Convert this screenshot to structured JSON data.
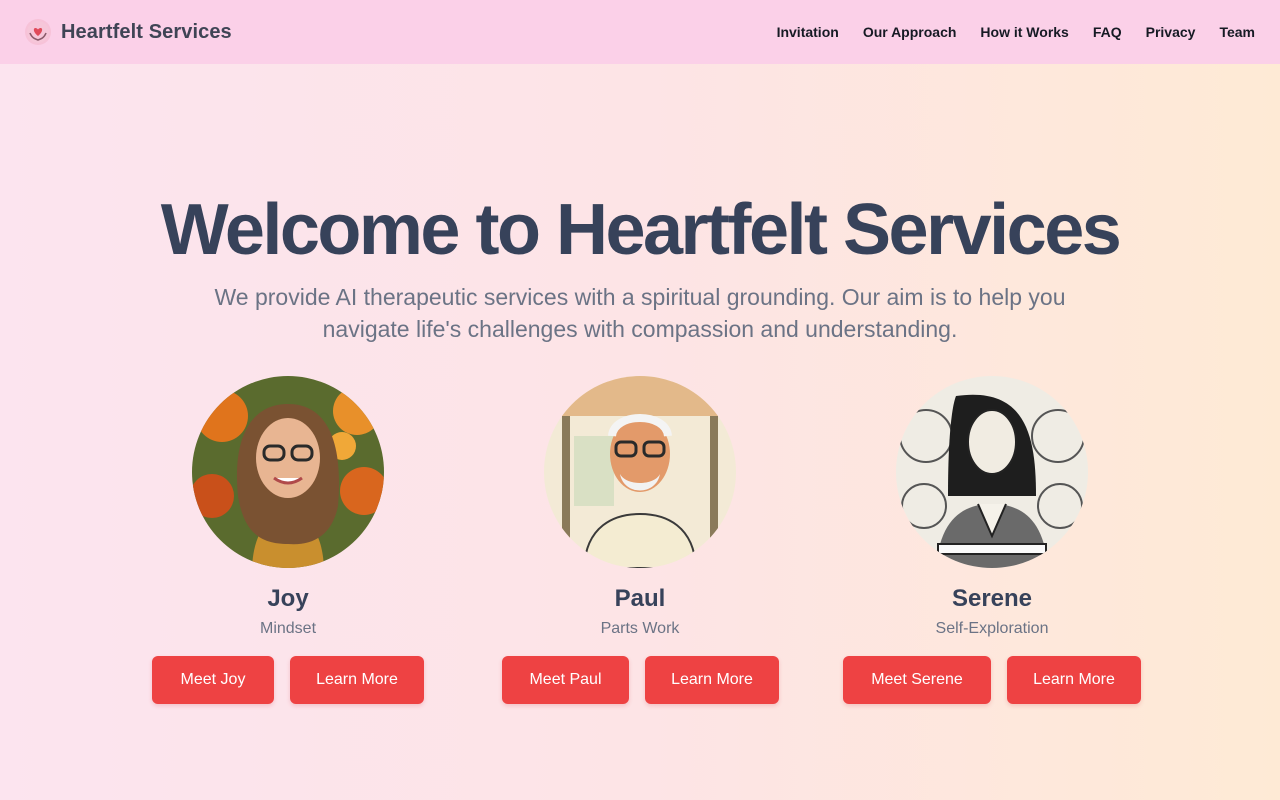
{
  "header": {
    "brand": "Heartfelt Services",
    "nav": [
      "Invitation",
      "Our Approach",
      "How it Works",
      "FAQ",
      "Privacy",
      "Team"
    ]
  },
  "hero": {
    "title": "Welcome to Heartfelt Services",
    "subtitle": "We provide AI therapeutic services with a spiritual grounding. Our aim is to help you navigate life's challenges with compassion and understanding."
  },
  "therapists": [
    {
      "name": "Joy",
      "role": "Mindset",
      "meet_label": "Meet Joy",
      "learn_label": "Learn More"
    },
    {
      "name": "Paul",
      "role": "Parts Work",
      "meet_label": "Meet Paul",
      "learn_label": "Learn More"
    },
    {
      "name": "Serene",
      "role": "Self-Exploration",
      "meet_label": "Meet Serene",
      "learn_label": "Learn More"
    }
  ],
  "colors": {
    "nav_bg": "#fbd0e8",
    "button": "#ee4243",
    "heading": "#37425a",
    "muted": "#6b7385"
  }
}
